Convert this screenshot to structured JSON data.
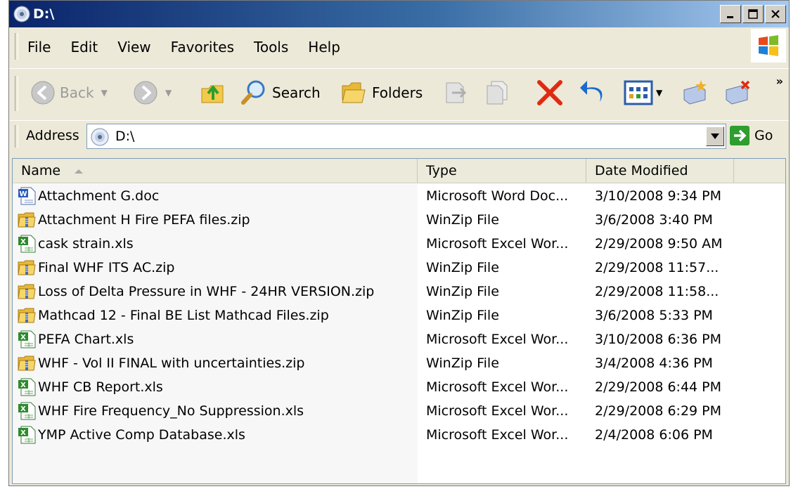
{
  "window": {
    "title": "D:\\",
    "controls": [
      "minimize",
      "maximize",
      "close"
    ]
  },
  "menu": {
    "items": [
      "File",
      "Edit",
      "View",
      "Favorites",
      "Tools",
      "Help"
    ]
  },
  "toolbar": {
    "back_label": "Back",
    "search_label": "Search",
    "folders_label": "Folders",
    "overflow": "»"
  },
  "address": {
    "label": "Address",
    "value": "D:\\",
    "go_label": "Go"
  },
  "columns": {
    "name": "Name",
    "type": "Type",
    "date": "Date Modified"
  },
  "files": [
    {
      "name": "Attachment G.doc",
      "type": "Microsoft Word Doc...",
      "date": "3/10/2008 9:34 PM",
      "icon": "word-doc-icon"
    },
    {
      "name": "Attachment H Fire PEFA files.zip",
      "type": "WinZip File",
      "date": "3/6/2008 3:40 PM",
      "icon": "zip-folder-icon"
    },
    {
      "name": "cask strain.xls",
      "type": "Microsoft Excel Wor...",
      "date": "2/29/2008 9:50 AM",
      "icon": "excel-icon"
    },
    {
      "name": "Final WHF ITS  AC.zip",
      "type": "WinZip File",
      "date": "2/29/2008 11:57...",
      "icon": "zip-folder-icon"
    },
    {
      "name": "Loss of Delta Pressure in WHF - 24HR VERSION.zip",
      "type": "WinZip File",
      "date": "2/29/2008 11:58...",
      "icon": "zip-folder-icon"
    },
    {
      "name": "Mathcad 12 -  Final BE List Mathcad Files.zip",
      "type": "WinZip File",
      "date": "3/6/2008 5:33 PM",
      "icon": "zip-folder-icon"
    },
    {
      "name": "PEFA Chart.xls",
      "type": "Microsoft Excel Wor...",
      "date": "3/10/2008 6:36 PM",
      "icon": "excel-icon"
    },
    {
      "name": "WHF - Vol II FINAL with uncertainties.zip",
      "type": "WinZip File",
      "date": "3/4/2008 4:36 PM",
      "icon": "zip-folder-icon"
    },
    {
      "name": "WHF CB Report.xls",
      "type": "Microsoft Excel Wor...",
      "date": "2/29/2008 6:44 PM",
      "icon": "excel-icon"
    },
    {
      "name": "WHF Fire Frequency_No Suppression.xls",
      "type": "Microsoft Excel Wor...",
      "date": "2/29/2008 6:29 PM",
      "icon": "excel-icon"
    },
    {
      "name": "YMP Active Comp Database.xls",
      "type": "Microsoft Excel Wor...",
      "date": "2/4/2008 6:06 PM",
      "icon": "excel-icon"
    }
  ],
  "colors": {
    "title_start": "#0a246a",
    "title_end": "#a6caf0",
    "chrome": "#ece9d8",
    "delete_red": "#e02a10",
    "go_green": "#2e9e2e"
  }
}
